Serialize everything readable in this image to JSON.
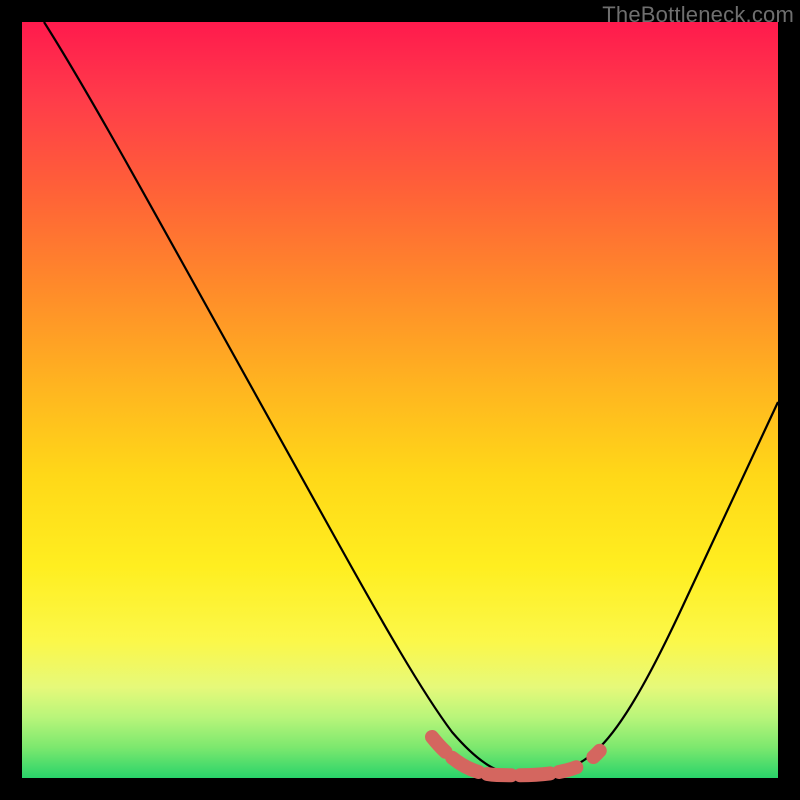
{
  "watermark": "TheBottleneck.com",
  "chart_data": {
    "type": "line",
    "title": "",
    "xlabel": "",
    "ylabel": "",
    "xlim": [
      0,
      100
    ],
    "ylim": [
      0,
      100
    ],
    "background_gradient": {
      "top_color": "#ff1a4d",
      "bottom_color": "#29d36a"
    },
    "series": [
      {
        "name": "black-curve",
        "color": "#000000",
        "x": [
          3,
          10,
          20,
          30,
          40,
          47,
          52,
          56,
          60,
          65,
          70,
          75,
          80,
          85,
          90,
          95,
          100
        ],
        "y": [
          100,
          88,
          71,
          54,
          37,
          23,
          13,
          6,
          2,
          0,
          0,
          1,
          4,
          12,
          24,
          38,
          50
        ]
      },
      {
        "name": "valley-highlight",
        "color": "#d4665f",
        "x": [
          55,
          58,
          62,
          66,
          70,
          74,
          77
        ],
        "y": [
          6,
          2,
          0.5,
          0,
          0,
          1,
          3
        ]
      }
    ]
  }
}
